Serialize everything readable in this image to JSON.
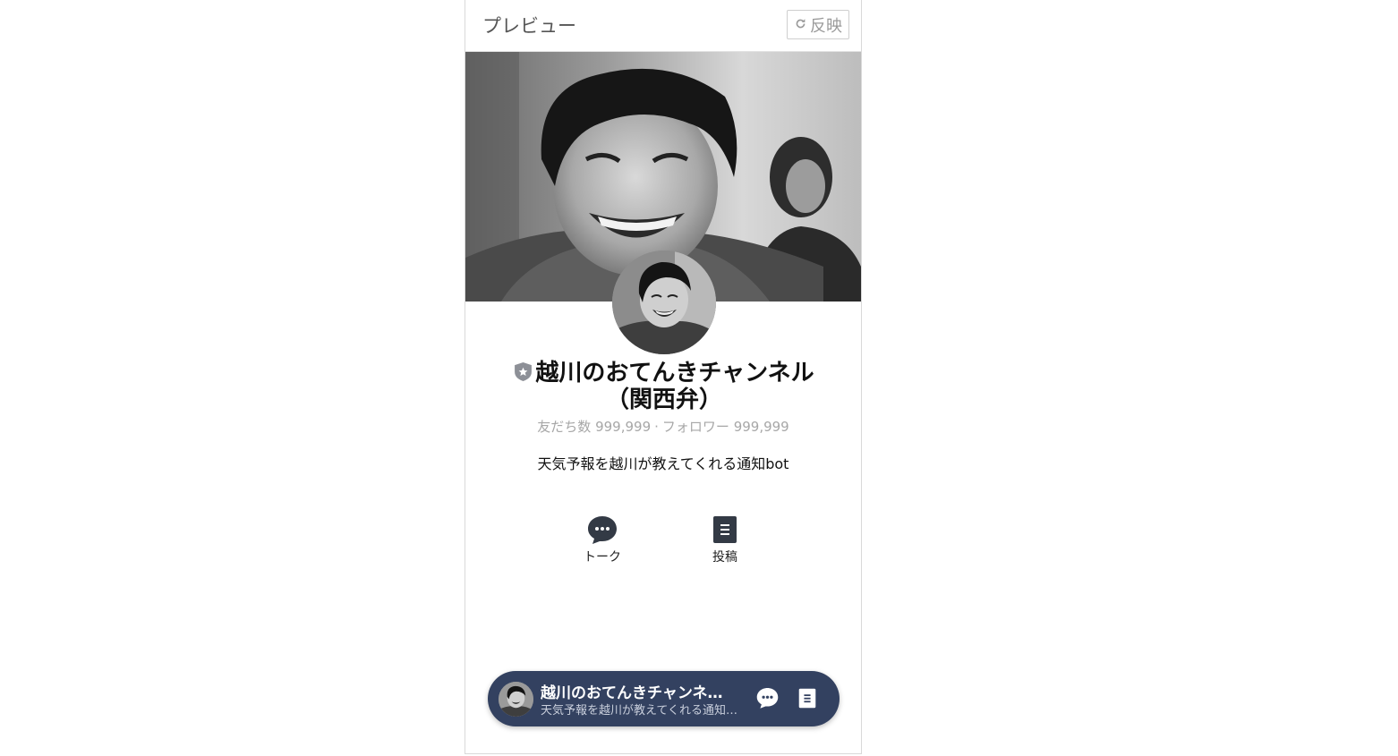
{
  "header": {
    "title": "プレビュー",
    "reflect_label": "反映",
    "reflect_icon": "refresh-icon"
  },
  "profile": {
    "name": "越川のおてんきチャンネル（関西弁）",
    "badge_icon": "verified-shield-icon",
    "friends_label": "友だち数",
    "friends_count": "999,999",
    "separator": "·",
    "followers_label": "フォロワー",
    "followers_count": "999,999",
    "description": "天気予報を越川が教えてくれる通知bot"
  },
  "actions": [
    {
      "label": "トーク",
      "icon": "chat-bubble-icon"
    },
    {
      "label": "投稿",
      "icon": "document-icon"
    }
  ],
  "floating_bar": {
    "name": "越川のおてんきチャンネル…",
    "description": "天気予報を越川が教えてくれる通知b…",
    "chat_icon": "chat-bubble-icon",
    "post_icon": "document-icon"
  },
  "colors": {
    "floating_bar_bg": "#334160",
    "muted_text": "#a7a7a7",
    "icon_dark": "#333a45"
  }
}
